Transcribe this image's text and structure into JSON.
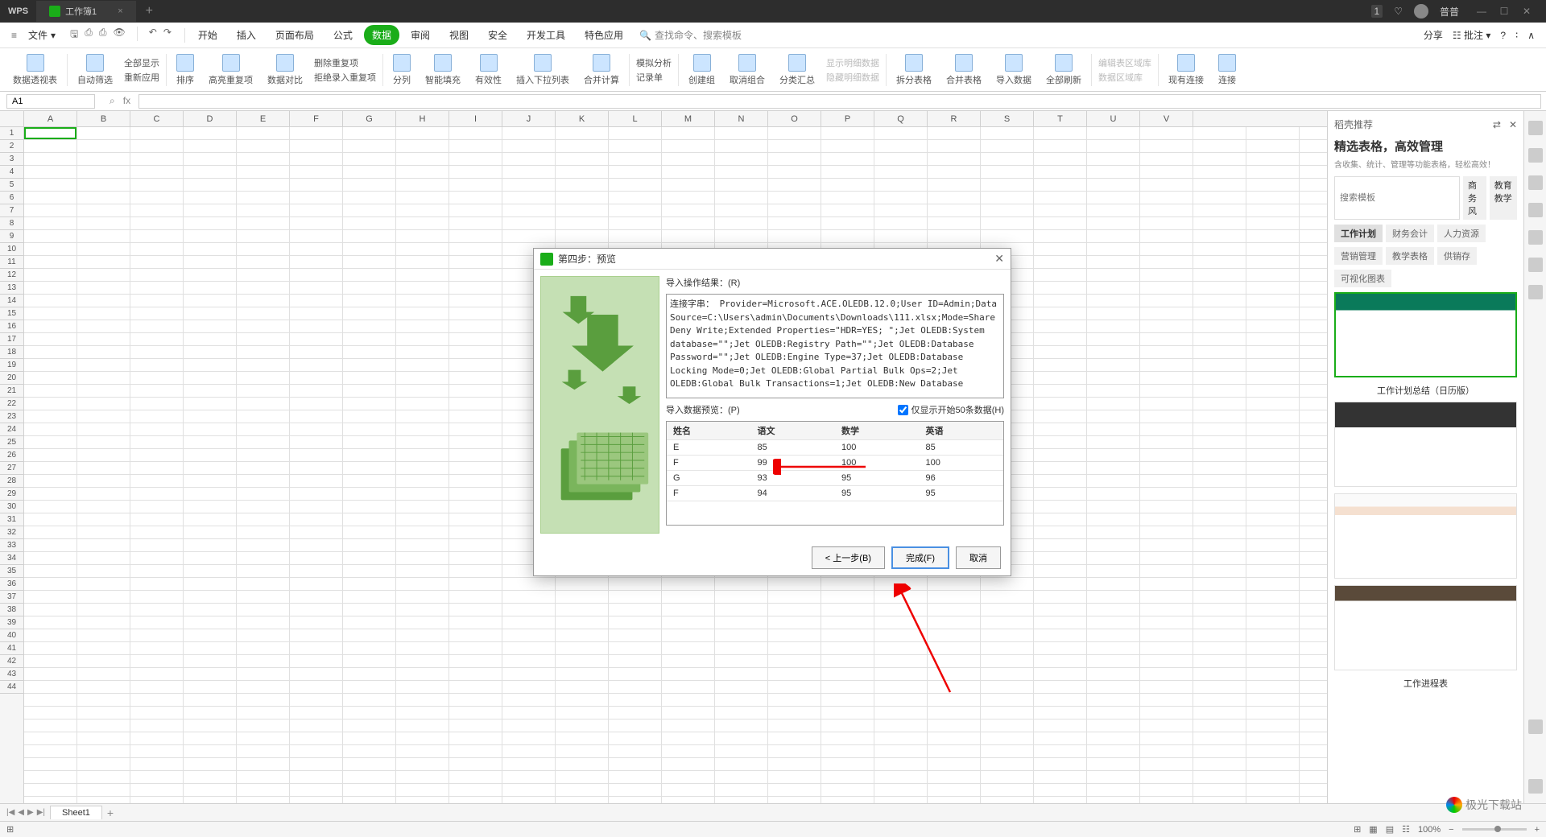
{
  "titlebar": {
    "wps": "WPS",
    "doc_name": "工作簿1",
    "badge": "1",
    "user": "普普"
  },
  "menu": {
    "file": "文件",
    "tabs": [
      "开始",
      "插入",
      "页面布局",
      "公式",
      "数据",
      "审阅",
      "视图",
      "安全",
      "开发工具",
      "特色应用"
    ],
    "active_index": 4,
    "search_placeholder": "查找命令、搜索模板",
    "share": "分享",
    "note": "批注"
  },
  "ribbon": [
    "数据透视表",
    "自动筛选",
    "全部显示",
    "重新应用",
    "排序",
    "高亮重复项",
    "数据对比",
    "删除重复项",
    "拒绝录入重复项",
    "分列",
    "智能填充",
    "有效性",
    "插入下拉列表",
    "合并计算",
    "模拟分析",
    "记录单",
    "创建组",
    "取消组合",
    "分类汇总",
    "显示明细数据",
    "隐藏明细数据",
    "拆分表格",
    "合并表格",
    "导入数据",
    "全部刷新",
    "编辑表区域库",
    "数据区域库",
    "现有连接",
    "连接"
  ],
  "namebox": "A1",
  "columns": [
    "A",
    "B",
    "C",
    "D",
    "E",
    "F",
    "G",
    "H",
    "I",
    "J",
    "K",
    "L",
    "M",
    "N",
    "O",
    "P",
    "Q",
    "R",
    "S",
    "T",
    "U",
    "V"
  ],
  "row_count": 44,
  "sheet_tab": "Sheet1",
  "panel": {
    "header": "稻壳推荐",
    "title": "精选表格，高效管理",
    "sub": "含收集、统计、管理等功能表格，轻松高效！",
    "search_placeholder": "搜索模板",
    "filter1": [
      "商务风",
      "教育教学"
    ],
    "filter2": [
      "工作计划",
      "财务会计",
      "人力资源"
    ],
    "filter3": [
      "营销管理",
      "教学表格",
      "供销存"
    ],
    "filter4": [
      "可视化图表"
    ],
    "tmpl1": "工作计划总结（日历版）",
    "tmpl4": "工作进程表"
  },
  "dialog": {
    "title": "第四步：预览",
    "result_label": "导入操作结果：(R)",
    "result_text": "连接字串：\nProvider=Microsoft.ACE.OLEDB.12.0;User ID=Admin;Data Source=C:\\Users\\admin\\Documents\\Downloads\\111.xlsx;Mode=Share Deny Write;Extended Properties=\"HDR=YES; \";Jet OLEDB:System database=\"\";Jet OLEDB:Registry Path=\"\";Jet OLEDB:Database Password=\"\";Jet OLEDB:Engine Type=37;Jet OLEDB:Database Locking Mode=0;Jet OLEDB:Global Partial Bulk Ops=2;Jet OLEDB:Global Bulk Transactions=1;Jet OLEDB:New Database",
    "preview_label": "导入数据预览：(P)",
    "checkbox": "仅显示开始50条数据(H)",
    "headers": [
      "姓名",
      "语文",
      "数学",
      "英语"
    ],
    "rows": [
      [
        "E",
        "85",
        "100",
        "85"
      ],
      [
        "F",
        "99",
        "100",
        "100"
      ],
      [
        "G",
        "93",
        "95",
        "96"
      ],
      [
        "F",
        "94",
        "95",
        "95"
      ]
    ],
    "back": "< 上一步(B)",
    "finish": "完成(F)",
    "cancel": "取消"
  },
  "status": {
    "zoom": "100%"
  },
  "chart_data": {
    "type": "table",
    "title": "导入数据预览",
    "headers": [
      "姓名",
      "语文",
      "数学",
      "英语"
    ],
    "rows": [
      {
        "姓名": "E",
        "语文": 85,
        "数学": 100,
        "英语": 85
      },
      {
        "姓名": "F",
        "语文": 99,
        "数学": 100,
        "英语": 100
      },
      {
        "姓名": "G",
        "语文": 93,
        "数学": 95,
        "英语": 96
      },
      {
        "姓名": "F",
        "语文": 94,
        "数学": 95,
        "英语": 95
      }
    ]
  }
}
